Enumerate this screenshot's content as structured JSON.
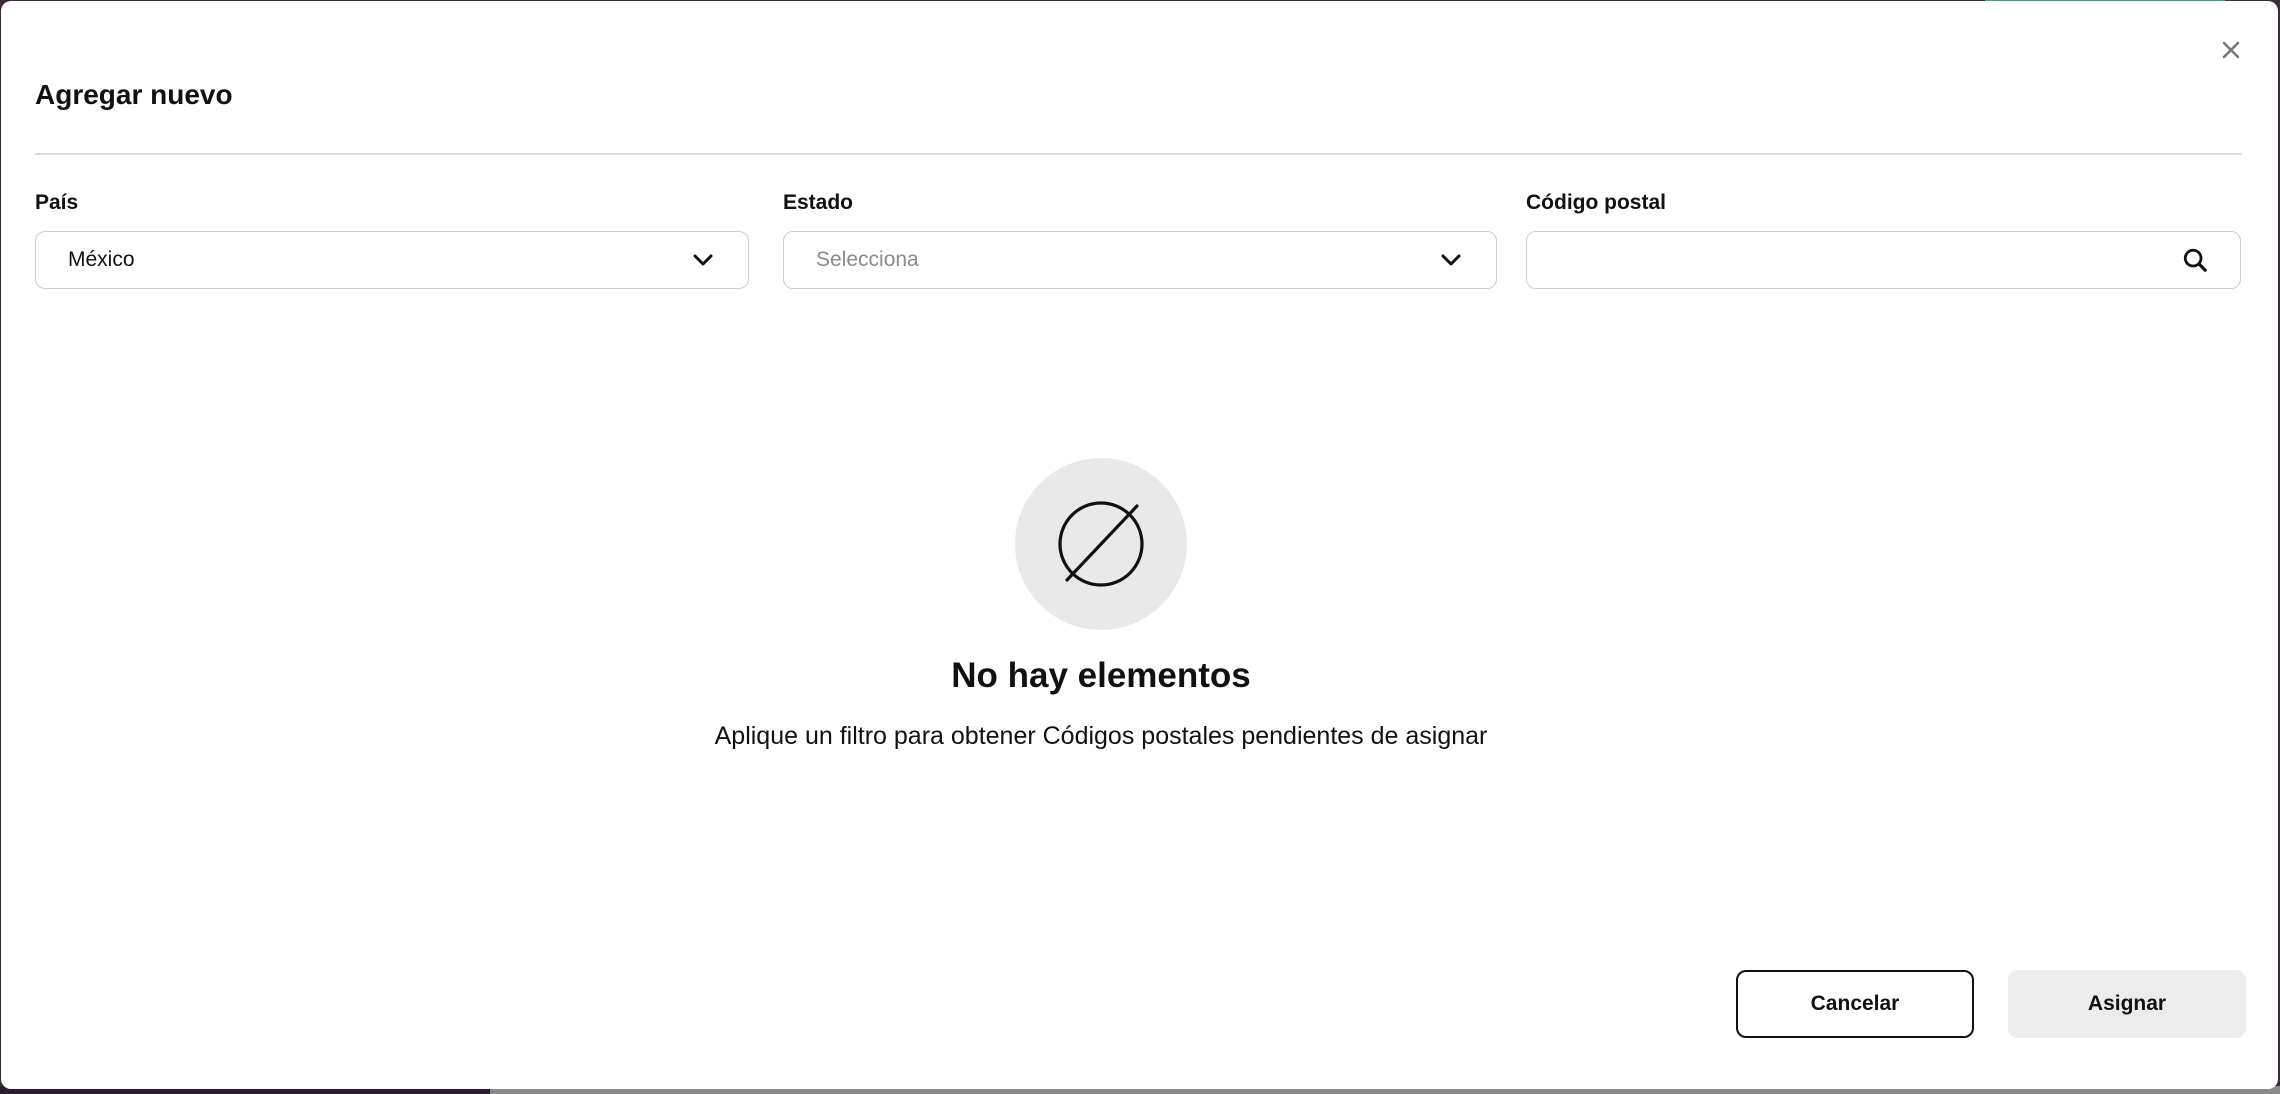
{
  "modal": {
    "title": "Agregar nuevo",
    "close_icon": "close-icon"
  },
  "filters": {
    "country": {
      "label": "País",
      "value": "México",
      "icon": "chevron-down-icon"
    },
    "state": {
      "label": "Estado",
      "placeholder": "Selecciona",
      "icon": "chevron-down-icon"
    },
    "postal_code": {
      "label": "Código postal",
      "value": "",
      "icon": "search-icon"
    }
  },
  "empty_state": {
    "icon": "empty-set-icon",
    "title": "No hay elementos",
    "description": "Aplique un filtro para obtener Códigos postales pendientes de asignar"
  },
  "footer": {
    "cancel_label": "Cancelar",
    "assign_label": "Asignar"
  },
  "colors": {
    "accent": "#3aa877",
    "disabled_button": "#ececec",
    "border": "#cfcfcf"
  }
}
